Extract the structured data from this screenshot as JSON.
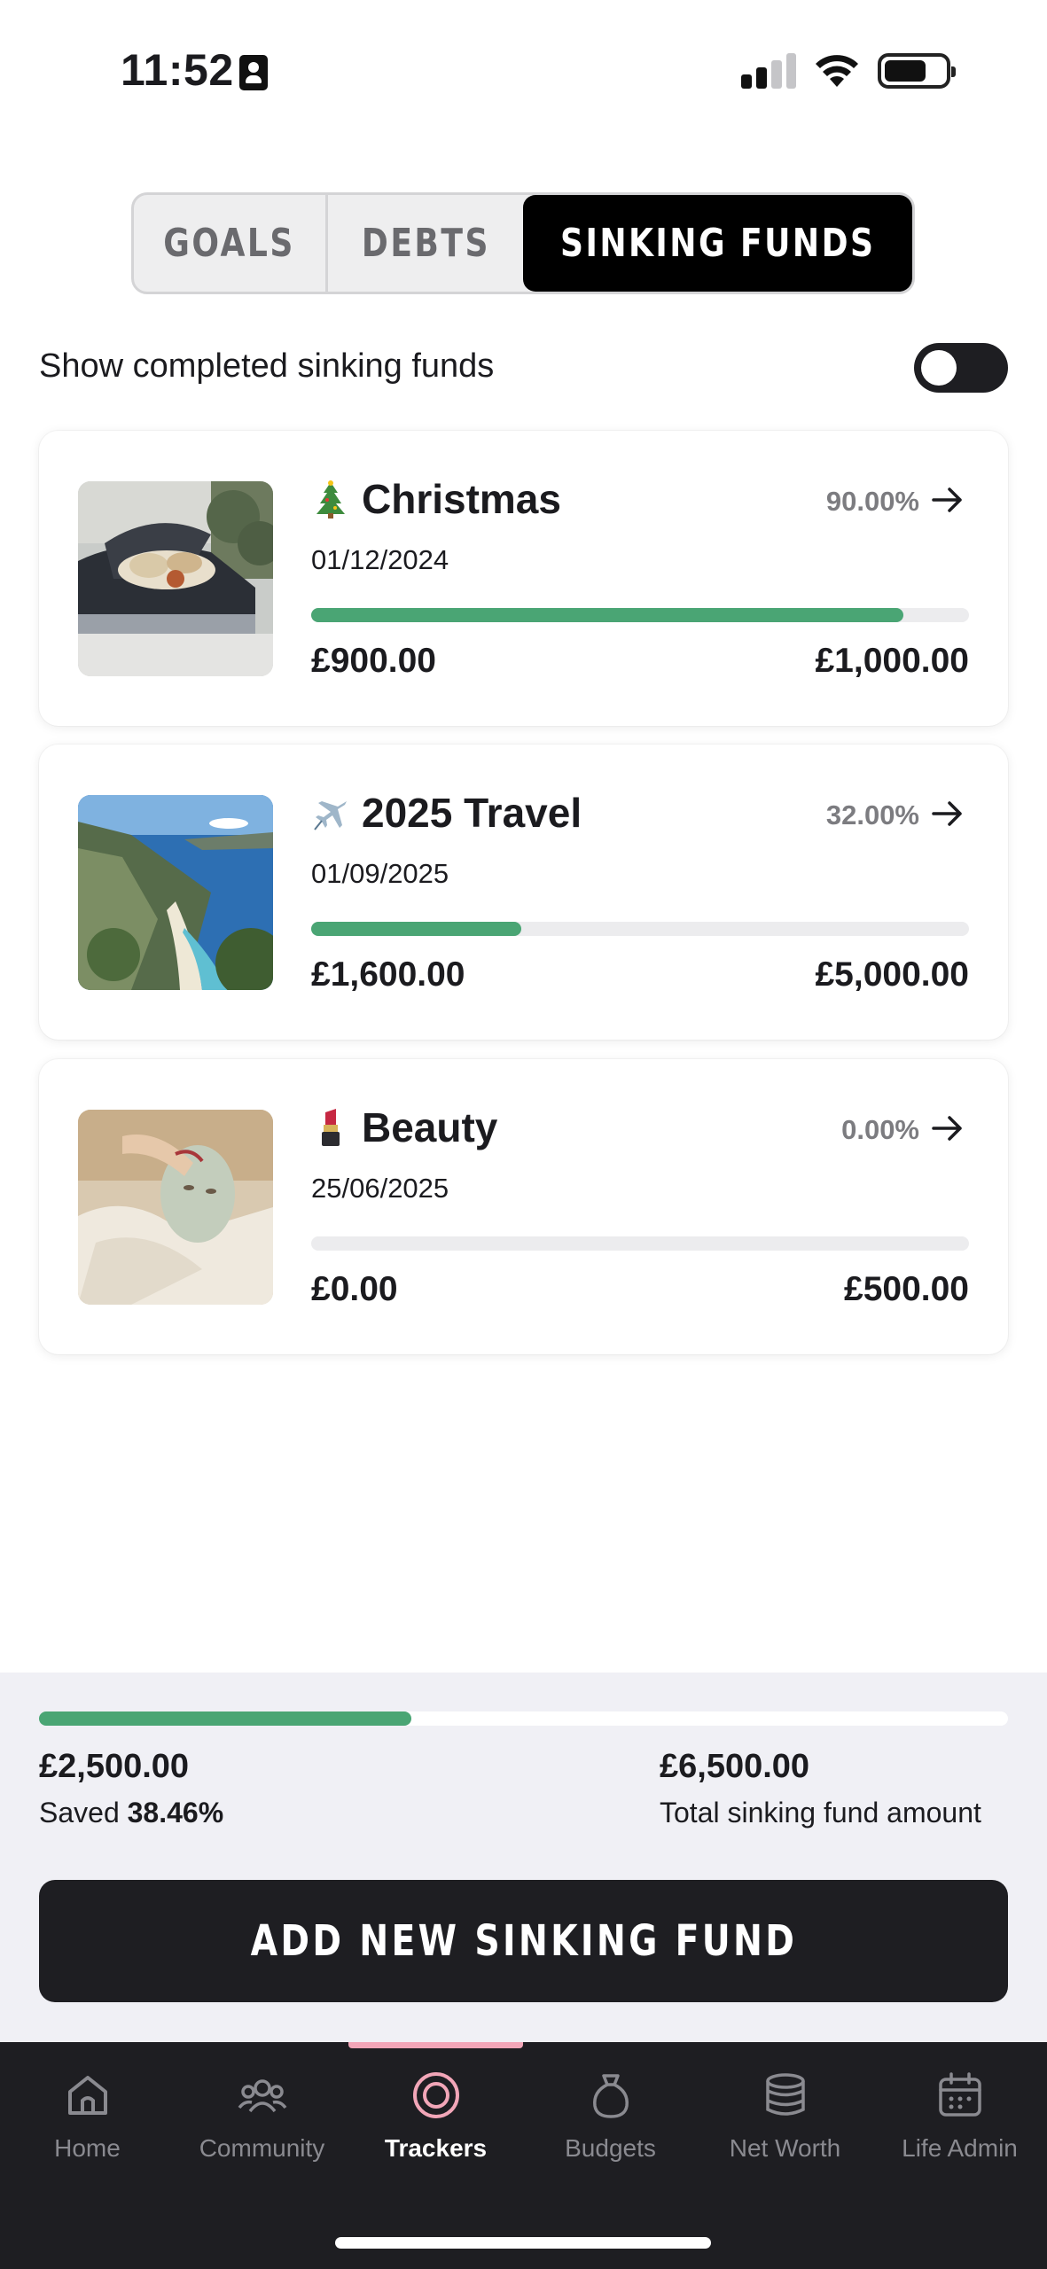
{
  "status_bar": {
    "time": "11:52"
  },
  "tabs": {
    "goals": "GOALS",
    "debts": "DEBTS",
    "sinking": "SINKING FUNDS",
    "active": "sinking"
  },
  "toggle": {
    "label": "Show completed sinking funds",
    "on": false
  },
  "funds": [
    {
      "emoji": "christmas-tree-icon",
      "title": "Christmas",
      "date": "01/12/2024",
      "percent": "90.00%",
      "progress": 0.9,
      "saved": "£900.00",
      "target": "£1,000.00",
      "thumbnail": "car-trunk-photo"
    },
    {
      "emoji": "airplane-icon",
      "title": "2025 Travel",
      "date": "01/09/2025",
      "percent": "32.00%",
      "progress": 0.32,
      "saved": "£1,600.00",
      "target": "£5,000.00",
      "thumbnail": "coastal-beach-photo"
    },
    {
      "emoji": "lipstick-icon",
      "title": "Beauty",
      "date": "25/06/2025",
      "percent": "0.00%",
      "progress": 0.0,
      "saved": "£0.00",
      "target": "£500.00",
      "thumbnail": "face-mask-photo"
    }
  ],
  "summary": {
    "saved": "£2,500.00",
    "saved_label": "Saved",
    "saved_percent": "38.46%",
    "progress": 0.3846,
    "total": "£6,500.00",
    "total_label": "Total sinking fund amount"
  },
  "add_button": "ADD NEW SINKING FUND",
  "nav": [
    {
      "label": "Home",
      "icon": "home-icon"
    },
    {
      "label": "Community",
      "icon": "community-icon"
    },
    {
      "label": "Trackers",
      "icon": "trackers-icon",
      "active": true
    },
    {
      "label": "Budgets",
      "icon": "budgets-icon"
    },
    {
      "label": "Net Worth",
      "icon": "net-worth-icon"
    },
    {
      "label": "Life Admin",
      "icon": "calendar-icon"
    }
  ],
  "colors": {
    "accent_green": "#4aa574",
    "dark": "#1e1e22",
    "nav_indicator": "#f2a6b8",
    "summary_bg": "#f0f0f5"
  }
}
